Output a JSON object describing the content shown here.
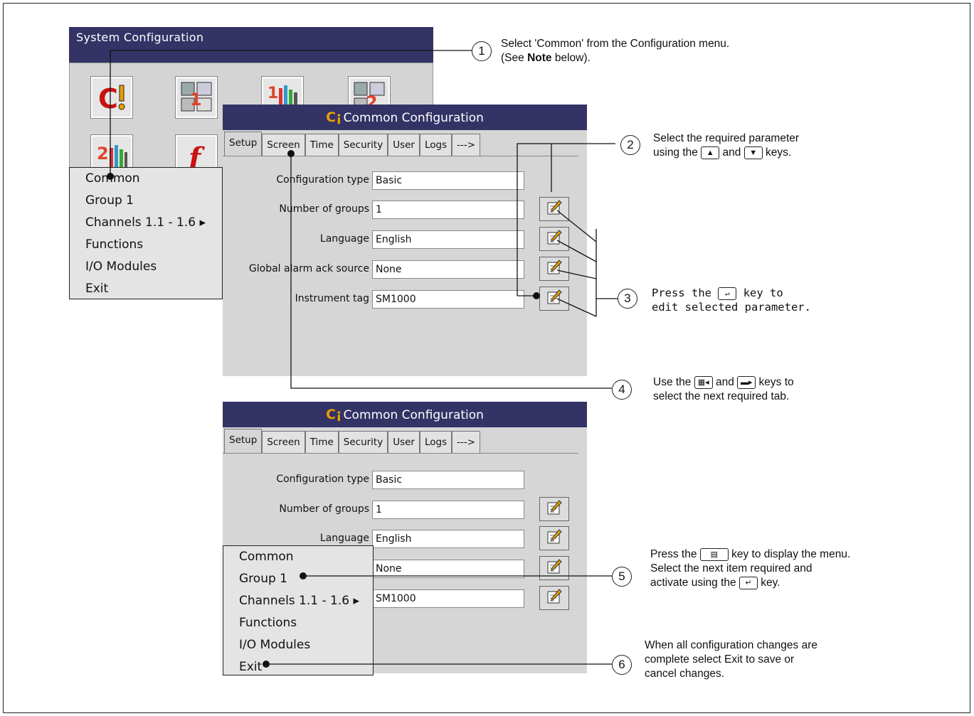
{
  "system_window": {
    "title": "System Configuration",
    "menu": [
      "Common",
      "Group 1",
      "Channels 1.1 - 1.6 ▸",
      "Functions",
      "I/O Modules",
      "Exit"
    ]
  },
  "common_window": {
    "title_icon": "C¡",
    "title": "Common Configuration",
    "tabs": [
      "Setup",
      "Screen",
      "Time",
      "Security",
      "User",
      "Logs",
      "--->"
    ],
    "fields": [
      {
        "label": "Configuration type",
        "value": "Basic"
      },
      {
        "label": "Number of groups",
        "value": "1"
      },
      {
        "label": "Language",
        "value": "English"
      },
      {
        "label": "Global alarm ack source",
        "value": "None"
      },
      {
        "label": "Instrument tag",
        "value": "SM1000"
      }
    ]
  },
  "common_menu": [
    "Common",
    "Group 1",
    "Channels 1.1 - 1.6 ▸",
    "Functions",
    "I/O Modules",
    "Exit"
  ],
  "callouts": {
    "c1": {
      "num": "1",
      "line1": "Select 'Common' from the Configuration menu.",
      "line2a": "(See ",
      "line2b": "Note",
      "line2c": " below)."
    },
    "c2": {
      "num": "2",
      "line1": "Select the required parameter",
      "line2a": "using the",
      "line2b": "and",
      "line2c": "keys."
    },
    "c3": {
      "num": "3",
      "line1a": "Press the",
      "line1b": "key to",
      "line2": "edit selected parameter."
    },
    "c4": {
      "num": "4",
      "line1a": "Use the",
      "line1b": "and",
      "line1c": "keys to",
      "line2": "select the next required tab."
    },
    "c5": {
      "num": "5",
      "line1a": "Press the",
      "line1b": "key to display the menu.",
      "line2": "Select the next item required and",
      "line3a": "activate using the",
      "line3b": "key."
    },
    "c6": {
      "num": "6",
      "line1": "When all configuration changes are",
      "line2": "complete select Exit to save or",
      "line3": "cancel changes."
    }
  },
  "icons": [
    "common-config-icon",
    "group1-config-icon",
    "channels1-config-icon",
    "group2-config-icon",
    "channels2-config-icon",
    "functions-icon",
    "edit-icon",
    "up-arrow-key-icon",
    "down-arrow-key-icon",
    "enter-key-icon",
    "left-tab-key-icon",
    "right-tab-key-icon",
    "menu-key-icon"
  ],
  "colors": {
    "title_bar": "#333366",
    "window_bg": "#d6d6d6",
    "accent_orange": "#e8a000",
    "accent_red": "#cc1111"
  }
}
